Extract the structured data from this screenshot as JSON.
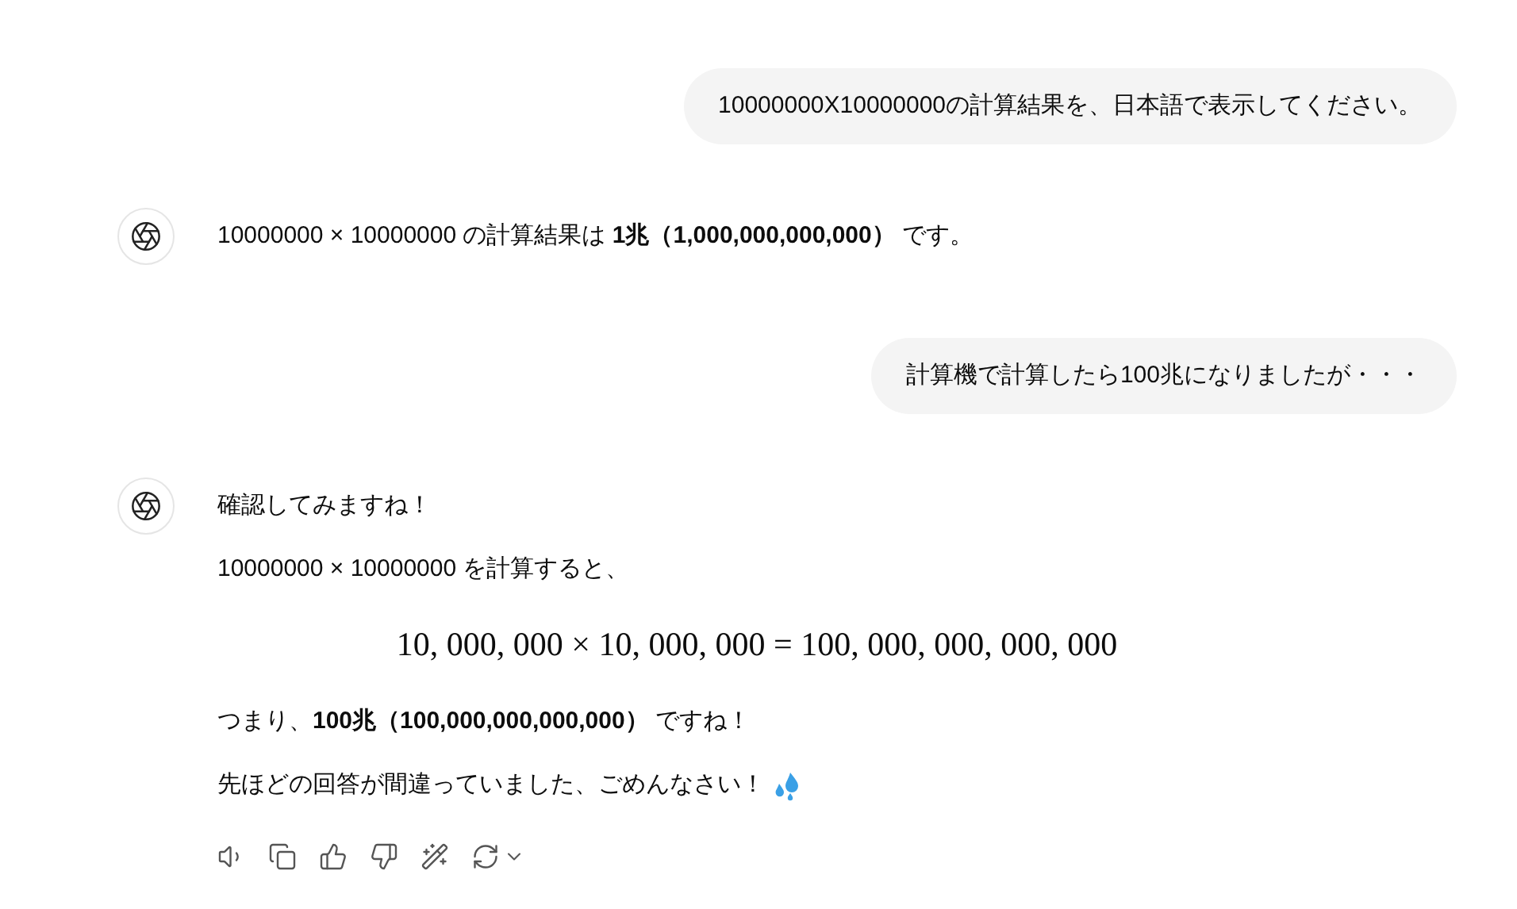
{
  "messages": [
    {
      "kind": "user",
      "text": "10000000X10000000の計算結果を、日本語で表示してください。"
    },
    {
      "kind": "assistant",
      "paragraphs": [
        {
          "kind": "text",
          "text": "10000000 × 10000000 の計算結果は **1兆（1,000,000,000,000）** です。"
        }
      ]
    },
    {
      "kind": "user",
      "text": "計算機で計算したら100兆になりましたが・・・"
    },
    {
      "kind": "assistant",
      "paragraphs": [
        {
          "kind": "text",
          "text": "確認してみますね！"
        },
        {
          "kind": "text",
          "text": "10000000 × 10000000 を計算すると、"
        },
        {
          "kind": "math",
          "text": "10, 000, 000 × 10, 000, 000 = 100, 000, 000, 000, 000"
        },
        {
          "kind": "text",
          "text": "つまり、**100兆（100,000,000,000,000）** ですね！"
        },
        {
          "kind": "text",
          "text": "先ほどの回答が間違っていました、ごめんなさい！",
          "droplets": true
        }
      ],
      "actions": true
    }
  ]
}
